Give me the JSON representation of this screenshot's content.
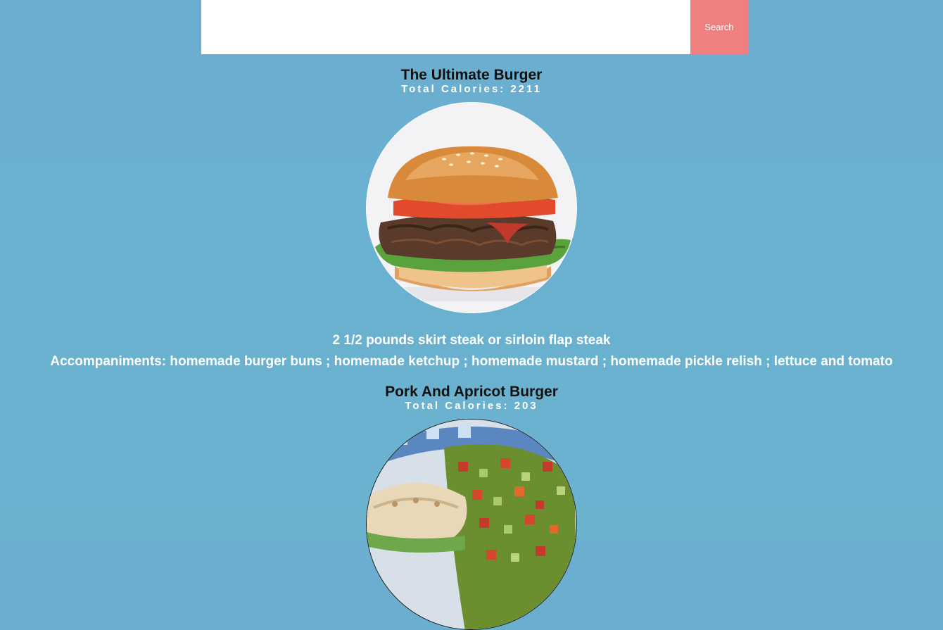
{
  "search": {
    "value": "",
    "placeholder": "",
    "button_label": "Search"
  },
  "recipes": [
    {
      "title": "The Ultimate Burger",
      "calories": "Total Calories: 2211",
      "image_icon": "burger-photo",
      "ingredients": [
        "2 1/2 pounds skirt steak or sirloin flap steak",
        "Accompaniments: homemade burger buns ; homemade ketchup ; homemade mustard ; homemade pickle relish ; lettuce and tomato"
      ]
    },
    {
      "title": "Pork And Apricot Burger",
      "calories": "Total Calories: 203",
      "image_icon": "pork-burger-salad-photo"
    }
  ],
  "colors": {
    "background": "#6aafcf",
    "search_button": "#f08080",
    "title_text": "#111111",
    "accent_text": "#ffffff"
  }
}
